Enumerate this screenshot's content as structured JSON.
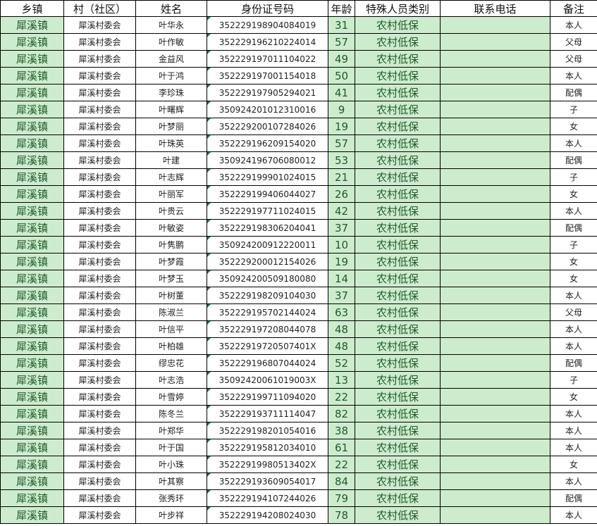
{
  "headers": [
    "乡镇",
    "村（社区）",
    "姓名",
    "身份证号码",
    "年龄",
    "特殊人员类别",
    "联系电话",
    "备注"
  ],
  "rows": [
    [
      "犀溪镇",
      "犀溪村委会",
      "叶华永",
      "352229198904084019",
      "31",
      "农村低保",
      "",
      "本人"
    ],
    [
      "犀溪镇",
      "犀溪村委会",
      "叶作敏",
      "352229196210224014",
      "57",
      "农村低保",
      "",
      "父母"
    ],
    [
      "犀溪镇",
      "犀溪村委会",
      "金益风",
      "352229197011104022",
      "49",
      "农村低保",
      "",
      "父母"
    ],
    [
      "犀溪镇",
      "犀溪村委会",
      "叶于鸿",
      "352229197001154018",
      "50",
      "农村低保",
      "",
      "本人"
    ],
    [
      "犀溪镇",
      "犀溪村委会",
      "李珍珠",
      "352229197905294021",
      "41",
      "农村低保",
      "",
      "配偶"
    ],
    [
      "犀溪镇",
      "犀溪村委会",
      "叶曙辉",
      "350924201012310016",
      "9",
      "农村低保",
      "",
      "子"
    ],
    [
      "犀溪镇",
      "犀溪村委会",
      "叶梦丽",
      "352229200107284026",
      "19",
      "农村低保",
      "",
      "女"
    ],
    [
      "犀溪镇",
      "犀溪村委会",
      "叶珠英",
      "352229196209154020",
      "57",
      "农村低保",
      "",
      "本人"
    ],
    [
      "犀溪镇",
      "犀溪村委会",
      "叶建",
      "350924196706080012",
      "53",
      "农村低保",
      "",
      "配偶"
    ],
    [
      "犀溪镇",
      "犀溪村委会",
      "叶志辉",
      "352229199901024015",
      "21",
      "农村低保",
      "",
      "子"
    ],
    [
      "犀溪镇",
      "犀溪村委会",
      "叶丽军",
      "352229199406044027",
      "26",
      "农村低保",
      "",
      "女"
    ],
    [
      "犀溪镇",
      "犀溪村委会",
      "叶贵云",
      "352229197711024015",
      "42",
      "农村低保",
      "",
      "本人"
    ],
    [
      "犀溪镇",
      "犀溪村委会",
      "叶敏姿",
      "352229198306204041",
      "37",
      "农村低保",
      "",
      "配偶"
    ],
    [
      "犀溪镇",
      "犀溪村委会",
      "叶隽鹏",
      "350924200912220011",
      "10",
      "农村低保",
      "",
      "子"
    ],
    [
      "犀溪镇",
      "犀溪村委会",
      "叶梦霞",
      "352229200012154026",
      "19",
      "农村低保",
      "",
      "女"
    ],
    [
      "犀溪镇",
      "犀溪村委会",
      "叶梦玉",
      "350924200509180080",
      "14",
      "农村低保",
      "",
      "女"
    ],
    [
      "犀溪镇",
      "犀溪村委会",
      "叶树董",
      "352229198209104030",
      "37",
      "农村低保",
      "",
      "本人"
    ],
    [
      "犀溪镇",
      "犀溪村委会",
      "陈淑兰",
      "352229195702144024",
      "63",
      "农村低保",
      "",
      "父母"
    ],
    [
      "犀溪镇",
      "犀溪村委会",
      "叶信平",
      "352229197208044078",
      "48",
      "农村低保",
      "",
      "本人"
    ],
    [
      "犀溪镇",
      "犀溪村委会",
      "叶柏雄",
      "35222919720507401X",
      "48",
      "农村低保",
      "",
      "本人"
    ],
    [
      "犀溪镇",
      "犀溪村委会",
      "缪忠花",
      "352229196807044024",
      "52",
      "农村低保",
      "",
      "配偶"
    ],
    [
      "犀溪镇",
      "犀溪村委会",
      "叶志浩",
      "35092420061019003X",
      "13",
      "农村低保",
      "",
      "子"
    ],
    [
      "犀溪镇",
      "犀溪村委会",
      "叶雪婷",
      "352229199711094020",
      "22",
      "农村低保",
      "",
      "女"
    ],
    [
      "犀溪镇",
      "犀溪村委会",
      "陈冬兰",
      "352229193711114047",
      "82",
      "农村低保",
      "",
      "本人"
    ],
    [
      "犀溪镇",
      "犀溪村委会",
      "叶郑华",
      "352229198201054016",
      "38",
      "农村低保",
      "",
      "本人"
    ],
    [
      "犀溪镇",
      "犀溪村委会",
      "叶于国",
      "352229195812034010",
      "61",
      "农村低保",
      "",
      "本人"
    ],
    [
      "犀溪镇",
      "犀溪村委会",
      "叶小珠",
      "35222919980513402X",
      "22",
      "农村低保",
      "",
      "女"
    ],
    [
      "犀溪镇",
      "犀溪村委会",
      "叶其察",
      "352229193609054017",
      "84",
      "农村低保",
      "",
      "本人"
    ],
    [
      "犀溪镇",
      "犀溪村委会",
      "张秀环",
      "352229194107244026",
      "79",
      "农村低保",
      "",
      "配偶"
    ],
    [
      "犀溪镇",
      "犀溪村委会",
      "叶步祥",
      "352229194208024030",
      "78",
      "农村低保",
      "",
      "本人"
    ]
  ],
  "colors": {
    "highlight_fill": "#cdeccd",
    "highlight_text": "#1d5a2a",
    "grid": "#000000"
  }
}
